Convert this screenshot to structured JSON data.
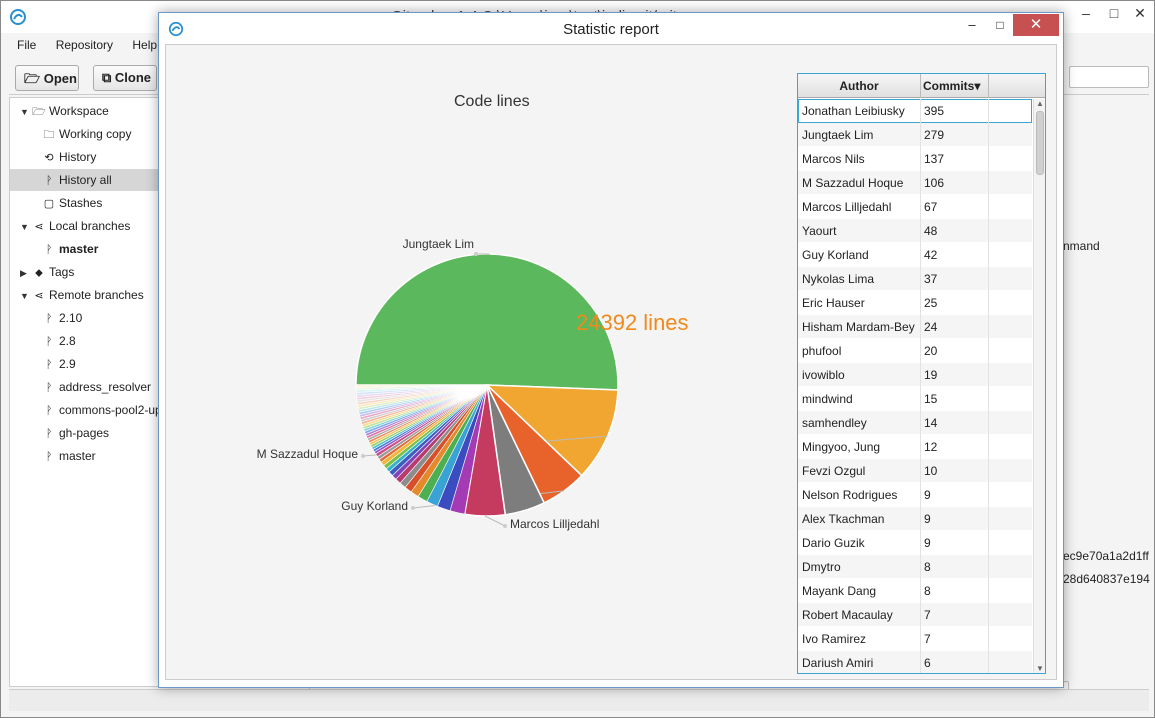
{
  "main_window": {
    "title": "Gitember 1.4  C:\\Users\\igor\\test\\jedis.git/.git"
  },
  "menu": [
    "File",
    "Repository",
    "Help"
  ],
  "toolbar": {
    "open_label": "Open",
    "clone_label": "Clone"
  },
  "sidebar": {
    "items": [
      {
        "label": "Workspace",
        "icon": "folder-open-icon",
        "arrow": "▼",
        "indent": 0
      },
      {
        "label": "Working copy",
        "icon": "folder-icon",
        "arrow": "",
        "indent": 1
      },
      {
        "label": "History",
        "icon": "history-icon",
        "arrow": "",
        "indent": 1
      },
      {
        "label": "History all",
        "icon": "branch-icon",
        "arrow": "",
        "indent": 1,
        "selected": true
      },
      {
        "label": "Stashes",
        "icon": "stash-icon",
        "arrow": "",
        "indent": 1
      },
      {
        "label": "Local branches",
        "icon": "share-icon",
        "arrow": "▼",
        "indent": 0
      },
      {
        "label": "master",
        "icon": "branch-icon",
        "arrow": "",
        "indent": 1,
        "bold": true
      },
      {
        "label": "Tags",
        "icon": "tag-icon",
        "arrow": "▶",
        "indent": 0
      },
      {
        "label": "Remote branches",
        "icon": "share-icon",
        "arrow": "▼",
        "indent": 0
      },
      {
        "label": "2.10",
        "icon": "branch-icon",
        "arrow": "",
        "indent": 1
      },
      {
        "label": "2.8",
        "icon": "branch-icon",
        "arrow": "",
        "indent": 1
      },
      {
        "label": "2.9",
        "icon": "branch-icon",
        "arrow": "",
        "indent": 1
      },
      {
        "label": "address_resolver",
        "icon": "branch-icon",
        "arrow": "",
        "indent": 1
      },
      {
        "label": "commons-pool2-up",
        "icon": "branch-icon",
        "arrow": "",
        "indent": 1
      },
      {
        "label": "gh-pages",
        "icon": "branch-icon",
        "arrow": "",
        "indent": 1
      },
      {
        "label": "master",
        "icon": "branch-icon",
        "arrow": "",
        "indent": 1
      }
    ]
  },
  "background_right": {
    "text_1": "nmand",
    "hash_1": "ec9e70a1a2d1ff",
    "hash_2": "28d640837e194"
  },
  "dialog": {
    "title": "Statistic report",
    "minimize_glyph": "–",
    "maximize_glyph": "□",
    "close_glyph": "✕"
  },
  "chart_data": {
    "type": "pie",
    "title": "Code lines",
    "hover_label": "24392 lines",
    "slices": [
      {
        "label": "Jungtaek Lim",
        "value": 50.0,
        "color": "#5cb85c",
        "labeled": true
      },
      {
        "label": "M Sazzadul Hoque",
        "value": 11.4,
        "color": "#f0a630",
        "labeled": true
      },
      {
        "label": "Guy Korland",
        "value": 5.6,
        "color": "#e8622c",
        "labeled": true
      },
      {
        "label": "",
        "value": 4.9,
        "color": "#7d7d7d",
        "labeled": false
      },
      {
        "label": "Marcos Lilljedahl",
        "value": 4.9,
        "color": "#c53a5f",
        "labeled": true
      },
      {
        "label": "",
        "value": 1.8,
        "color": "#a43bb5",
        "labeled": false
      },
      {
        "label": "",
        "value": 1.6,
        "color": "#3b4cc0",
        "labeled": false
      },
      {
        "label": "",
        "value": 1.4,
        "color": "#3aa3d6",
        "labeled": false
      },
      {
        "label": "",
        "value": 1.2,
        "color": "#4caf50",
        "labeled": false
      },
      {
        "label": "",
        "value": 1.0,
        "color": "#e58a2c",
        "labeled": false
      },
      {
        "label": "",
        "value": 0.9,
        "color": "#d94f2a",
        "labeled": false
      },
      {
        "label": "",
        "value": 0.8,
        "color": "#8c8c8c",
        "labeled": false
      },
      {
        "label": "",
        "value": 0.7,
        "color": "#b73b6e",
        "labeled": false
      },
      {
        "label": "",
        "value": 0.6,
        "color": "#7e44b8",
        "labeled": false
      },
      {
        "label": "",
        "value": 0.6,
        "color": "#3c5ec2",
        "labeled": false
      },
      {
        "label": "",
        "value": 0.5,
        "color": "#35b3c9",
        "labeled": false
      },
      {
        "label": "",
        "value": 0.5,
        "color": "#7cbf47",
        "labeled": false
      },
      {
        "label": "",
        "value": 0.5,
        "color": "#f2b336",
        "labeled": false
      },
      {
        "label": "",
        "value": 0.4,
        "color": "#e06a3a",
        "labeled": false
      },
      {
        "label": "",
        "value": 0.4,
        "color": "#9a9a9a",
        "labeled": false
      },
      {
        "label": "",
        "value": 0.4,
        "color": "#cc4d83",
        "labeled": false
      },
      {
        "label": "",
        "value": 0.3,
        "color": "#9157c9",
        "labeled": false
      },
      {
        "label": "",
        "value": 0.3,
        "color": "#4f79d6",
        "labeled": false
      },
      {
        "label": "",
        "value": 0.3,
        "color": "#48c1cf",
        "labeled": false
      },
      {
        "label": "",
        "value": 0.3,
        "color": "#9ccf6a",
        "labeled": false
      },
      {
        "label": "",
        "value": 0.3,
        "color": "#f5c55a",
        "labeled": false
      },
      {
        "label": "",
        "value": 0.3,
        "color": "#eb8a63",
        "labeled": false
      },
      {
        "label": "",
        "value": 0.3,
        "color": "#b0b0b0",
        "labeled": false
      },
      {
        "label": "",
        "value": 0.3,
        "color": "#db7aa3",
        "labeled": false
      },
      {
        "label": "",
        "value": 0.3,
        "color": "#b08ad9",
        "labeled": false
      },
      {
        "label": "",
        "value": 0.3,
        "color": "#7fa6e6",
        "labeled": false
      },
      {
        "label": "",
        "value": 0.3,
        "color": "#85d6de",
        "labeled": false
      },
      {
        "label": "",
        "value": 0.3,
        "color": "#c0e19a",
        "labeled": false
      },
      {
        "label": "",
        "value": 0.3,
        "color": "#f8da93",
        "labeled": false
      },
      {
        "label": "",
        "value": 0.3,
        "color": "#f3b498",
        "labeled": false
      },
      {
        "label": "",
        "value": 0.3,
        "color": "#cfcfcf",
        "labeled": false
      },
      {
        "label": "",
        "value": 0.3,
        "color": "#e9a8c4",
        "labeled": false
      },
      {
        "label": "",
        "value": 0.3,
        "color": "#d0bce9",
        "labeled": false
      },
      {
        "label": "",
        "value": 0.3,
        "color": "#b3cdf1",
        "labeled": false
      },
      {
        "label": "",
        "value": 0.3,
        "color": "#b9e7ec",
        "labeled": false
      },
      {
        "label": "",
        "value": 0.3,
        "color": "#dcefc6",
        "labeled": false
      },
      {
        "label": "",
        "value": 0.3,
        "color": "#fbe9c2",
        "labeled": false
      },
      {
        "label": "",
        "value": 0.3,
        "color": "#f8d6c6",
        "labeled": false
      },
      {
        "label": "",
        "value": 0.3,
        "color": "#e6e6e6",
        "labeled": false
      },
      {
        "label": "",
        "value": 0.3,
        "color": "#f3cfdf",
        "labeled": false
      },
      {
        "label": "",
        "value": 0.3,
        "color": "#e6dcf4",
        "labeled": false
      },
      {
        "label": "",
        "value": 0.3,
        "color": "#d6e4f8",
        "labeled": false
      },
      {
        "label": "",
        "value": 0.3,
        "color": "#dcf3f5",
        "labeled": false
      },
      {
        "label": "",
        "value": 0.3,
        "color": "#eef7e2",
        "labeled": false
      },
      {
        "label": "",
        "value": 0.3,
        "color": "#fdf4e0",
        "labeled": false
      }
    ]
  },
  "table": {
    "columns": [
      "Author",
      "Commits"
    ],
    "sort_indicator": "▾",
    "rows": [
      {
        "author": "Jonathan Leibiusky",
        "commits": "395"
      },
      {
        "author": "Jungtaek Lim",
        "commits": "279"
      },
      {
        "author": "Marcos Nils",
        "commits": "137"
      },
      {
        "author": "M Sazzadul Hoque",
        "commits": "106"
      },
      {
        "author": "Marcos Lilljedahl",
        "commits": "67"
      },
      {
        "author": "Yaourt",
        "commits": "48"
      },
      {
        "author": "Guy Korland",
        "commits": "42"
      },
      {
        "author": "Nykolas Lima",
        "commits": "37"
      },
      {
        "author": "Eric Hauser",
        "commits": "25"
      },
      {
        "author": "Hisham Mardam-Bey",
        "commits": "24"
      },
      {
        "author": "phufool",
        "commits": "20"
      },
      {
        "author": "ivowiblo",
        "commits": "19"
      },
      {
        "author": "mindwind",
        "commits": "15"
      },
      {
        "author": "samhendley",
        "commits": "14"
      },
      {
        "author": "Mingyoo, Jung",
        "commits": "12"
      },
      {
        "author": "Fevzi Ozgul",
        "commits": "10"
      },
      {
        "author": "Nelson Rodrigues",
        "commits": "9"
      },
      {
        "author": "Alex Tkachman",
        "commits": "9"
      },
      {
        "author": "Dario Guzik",
        "commits": "9"
      },
      {
        "author": "Dmytro",
        "commits": "8"
      },
      {
        "author": "Mayank Dang",
        "commits": "8"
      },
      {
        "author": "Robert Macaulay",
        "commits": "7"
      },
      {
        "author": "Ivo Ramirez",
        "commits": "7"
      },
      {
        "author": "Dariush Amiri",
        "commits": "6"
      }
    ]
  },
  "colors": {
    "accent": "#3aa6d5",
    "hover_label": "#f08a1c",
    "close_button": "#c75050"
  }
}
